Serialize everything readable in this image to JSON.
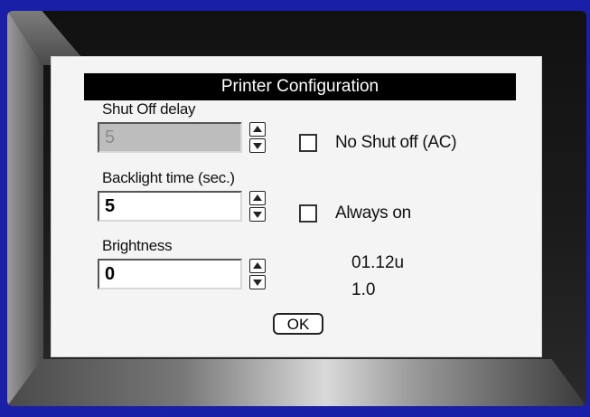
{
  "dialog": {
    "title": "Printer Configuration",
    "shut_off": {
      "label": "Shut Off delay",
      "value": "5"
    },
    "backlight": {
      "label": "Backlight time (sec.)",
      "value": "5"
    },
    "brightness": {
      "label": "Brightness",
      "value": "0"
    },
    "no_shut_off": {
      "label": "No Shut off (AC)",
      "checked": false
    },
    "always_on": {
      "label": "Always on",
      "checked": false
    },
    "version_1": "01.12u",
    "version_2": "1.0",
    "ok_label": "OK"
  }
}
